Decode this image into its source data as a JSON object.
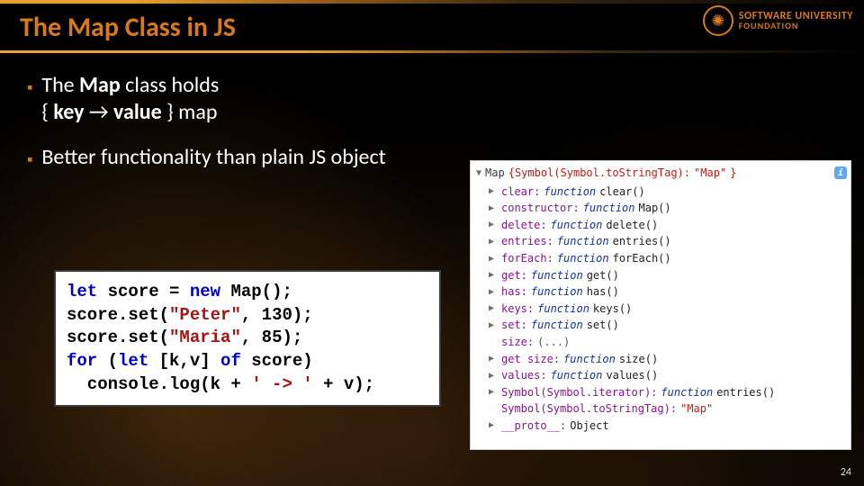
{
  "title": "The Map Class in JS",
  "logo": {
    "l1": "SOFTWARE UNIVERSITY",
    "l2": "FOUNDATION"
  },
  "bullets": [
    {
      "pre": "The ",
      "bold1": "Map",
      "mid": " class holds\n{ ",
      "bold2": "key ",
      "arrow": "→",
      "bold3": " value",
      "post": " } map"
    },
    {
      "text": "Better functionality than plain JS object"
    }
  ],
  "code": {
    "l1a": "let",
    "l1b": " score = ",
    "l1c": "new",
    "l1d": " Map();",
    "l2a": "score.set(",
    "l2b": "\"Peter\"",
    "l2c": ", 130);",
    "l3a": "score.set(",
    "l3b": "\"Maria\"",
    "l3c": ", 85);",
    "l4a": "for ",
    "l4b": "(",
    "l4c": "let ",
    "l4d": "[k,v] ",
    "l4e": "of ",
    "l4f": "score)",
    "l5a": "  console.log(k + ",
    "l5b": "' -> '",
    "l5c": " + v);"
  },
  "console": {
    "head_label": "Map ",
    "head_inner_key": "{Symbol(Symbol.toStringTag): ",
    "head_inner_val": "\"Map\"",
    "head_inner_close": "}",
    "rows": [
      {
        "prop": "clear",
        "fn": "function",
        "sig": "clear()"
      },
      {
        "prop": "constructor",
        "fn": "function",
        "sig": "Map()"
      },
      {
        "prop": "delete",
        "fn": "function",
        "sig": "delete()"
      },
      {
        "prop": "entries",
        "fn": "function",
        "sig": "entries()"
      },
      {
        "prop": "forEach",
        "fn": "function",
        "sig": "forEach()"
      },
      {
        "prop": "get",
        "fn": "function",
        "sig": "get()"
      },
      {
        "prop": "has",
        "fn": "function",
        "sig": "has()"
      },
      {
        "prop": "keys",
        "fn": "function",
        "sig": "keys()"
      },
      {
        "prop": "set",
        "fn": "function",
        "sig": "set()"
      },
      {
        "prop": "size",
        "plain": "(...)"
      },
      {
        "prop": "get size",
        "fn": "function",
        "sig": "size()"
      },
      {
        "prop": "values",
        "fn": "function",
        "sig": "values()"
      },
      {
        "prop": "Symbol(Symbol.iterator)",
        "fn": "function",
        "sig": "entries()"
      },
      {
        "prop": "Symbol(Symbol.toStringTag)",
        "str": "\"Map\""
      },
      {
        "prop": "__proto__",
        "plain2": "Object"
      }
    ]
  },
  "page_number": "24"
}
